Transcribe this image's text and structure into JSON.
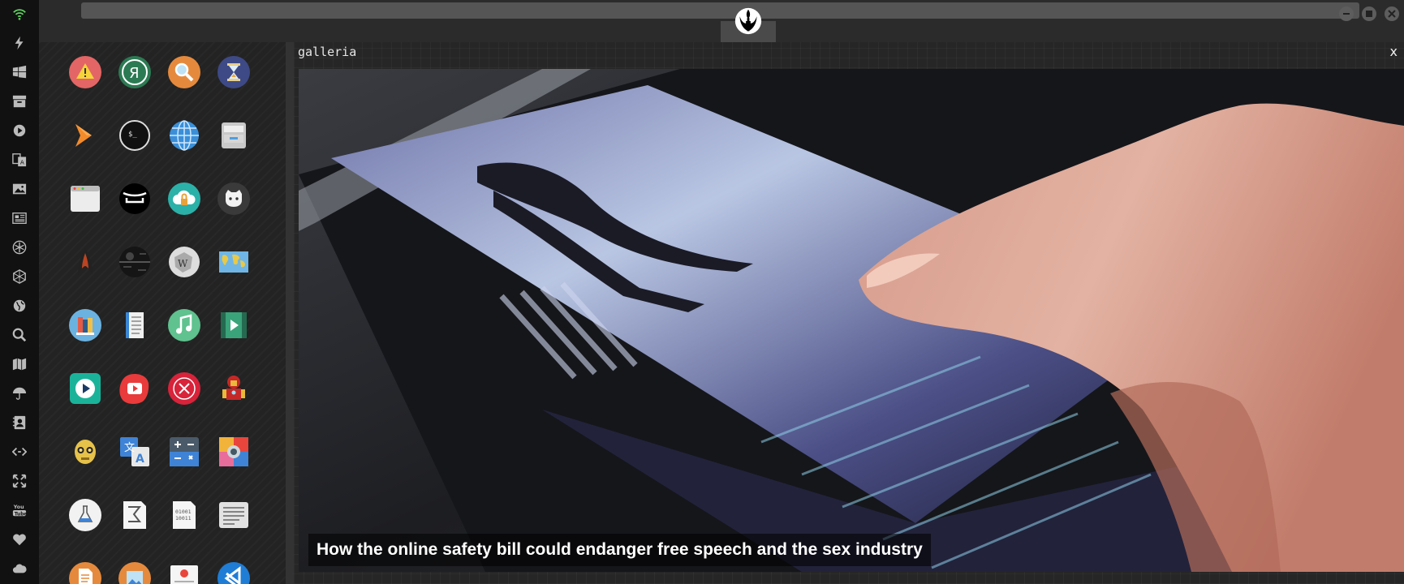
{
  "sidebar": {
    "icons": [
      "wifi-icon",
      "lightning-icon",
      "windows-icon",
      "archive-icon",
      "play-circle-icon",
      "translate-icon",
      "image-icon",
      "newspaper-icon",
      "rebel-alliance-icon",
      "hexagon-icon",
      "globe-icon",
      "search-icon",
      "map-icon",
      "umbrella-icon",
      "contacts-icon",
      "code-icon",
      "fullscreen-icon",
      "youtube-icon",
      "heart-icon",
      "cloud-icon"
    ]
  },
  "topbar": {
    "logo": "rebel-alliance-logo-icon",
    "controls": [
      "minimize-button",
      "maximize-button",
      "close-button"
    ]
  },
  "app_grid": {
    "icons": [
      "warning-app-icon",
      "yandex-app-icon",
      "search-app-icon",
      "hourglass-app-icon",
      "sublime-app-icon",
      "terminal-app-icon",
      "web-browser-app-icon",
      "file-cabinet-app-icon",
      "window-app-icon",
      "keyboard-app-icon",
      "cloud-lock-app-icon",
      "github-app-icon",
      "starfleet-app-icon",
      "death-star-app-icon",
      "wikipedia-app-icon",
      "world-map-app-icon",
      "library-app-icon",
      "notes-app-icon",
      "music-app-icon",
      "video-app-icon",
      "player-app-icon",
      "youtube-app-icon",
      "close-app-icon",
      "ironman-app-icon",
      "c3po-app-icon",
      "translate-app-icon",
      "calculator-app-icon",
      "photos-app-icon",
      "science-app-icon",
      "math-app-icon",
      "binary-file-app-icon",
      "text-editor-app-icon",
      "document-app-icon",
      "image-viewer-app-icon",
      "presentation-app-icon",
      "vscode-app-icon"
    ]
  },
  "panel": {
    "title": "galleria",
    "close": "x",
    "caption": "How the online safety bill could endanger free speech and the sex industry"
  }
}
